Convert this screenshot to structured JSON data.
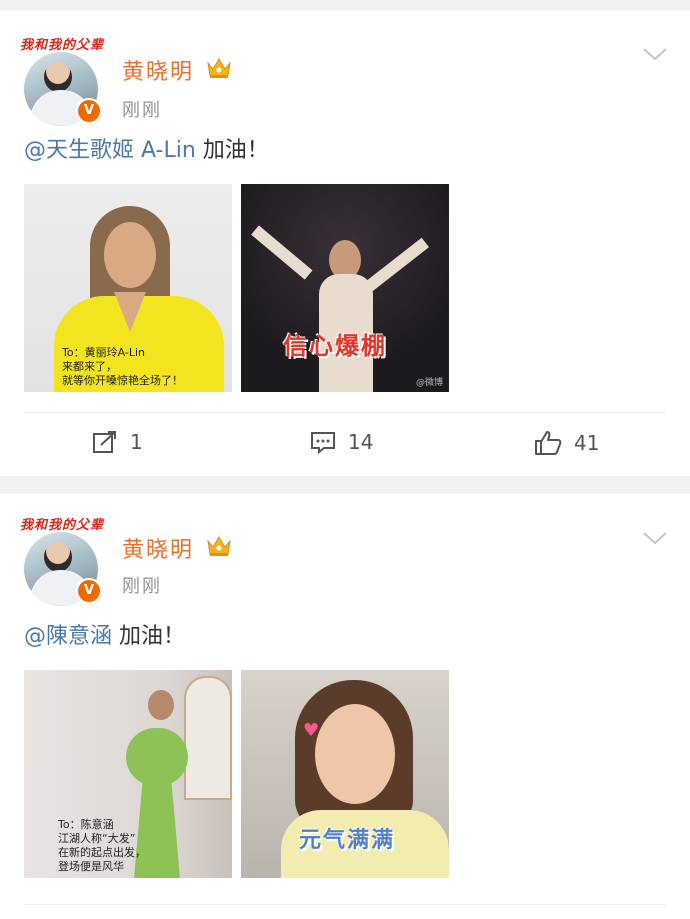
{
  "posts": [
    {
      "avatar_banner": "我和我的父辈",
      "username": "黄晓明",
      "timestamp": "刚刚",
      "mention": "@天生歌姬 A-Lin",
      "text_suffix": " 加油！",
      "images": [
        {
          "caption_lines": [
            "To：黄丽玲A-Lin",
            "来都来了，",
            "就等你开嗓惊艳全场了！"
          ]
        },
        {
          "overlay_text": "信心爆棚",
          "watermark": "@微博"
        }
      ],
      "actions": {
        "repost_count": "1",
        "comment_count": "14",
        "like_count": "41"
      }
    },
    {
      "avatar_banner": "我和我的父辈",
      "username": "黄晓明",
      "timestamp": "刚刚",
      "mention": "@陳意涵",
      "text_suffix": " 加油！",
      "images": [
        {
          "caption_lines": [
            "To：陈意涵",
            "江湖人称“大发”",
            "在新的起点出发，",
            "登场便是风华"
          ]
        },
        {
          "overlay_text": "元气满满"
        }
      ]
    }
  ],
  "colors": {
    "username": "#e8712b",
    "mention": "#4a78ad",
    "vip_badge": "#f06a00",
    "banner": "#d8261d"
  },
  "icons": [
    "crown-icon",
    "chevron-down-icon",
    "repost-icon",
    "comment-icon",
    "like-icon"
  ]
}
